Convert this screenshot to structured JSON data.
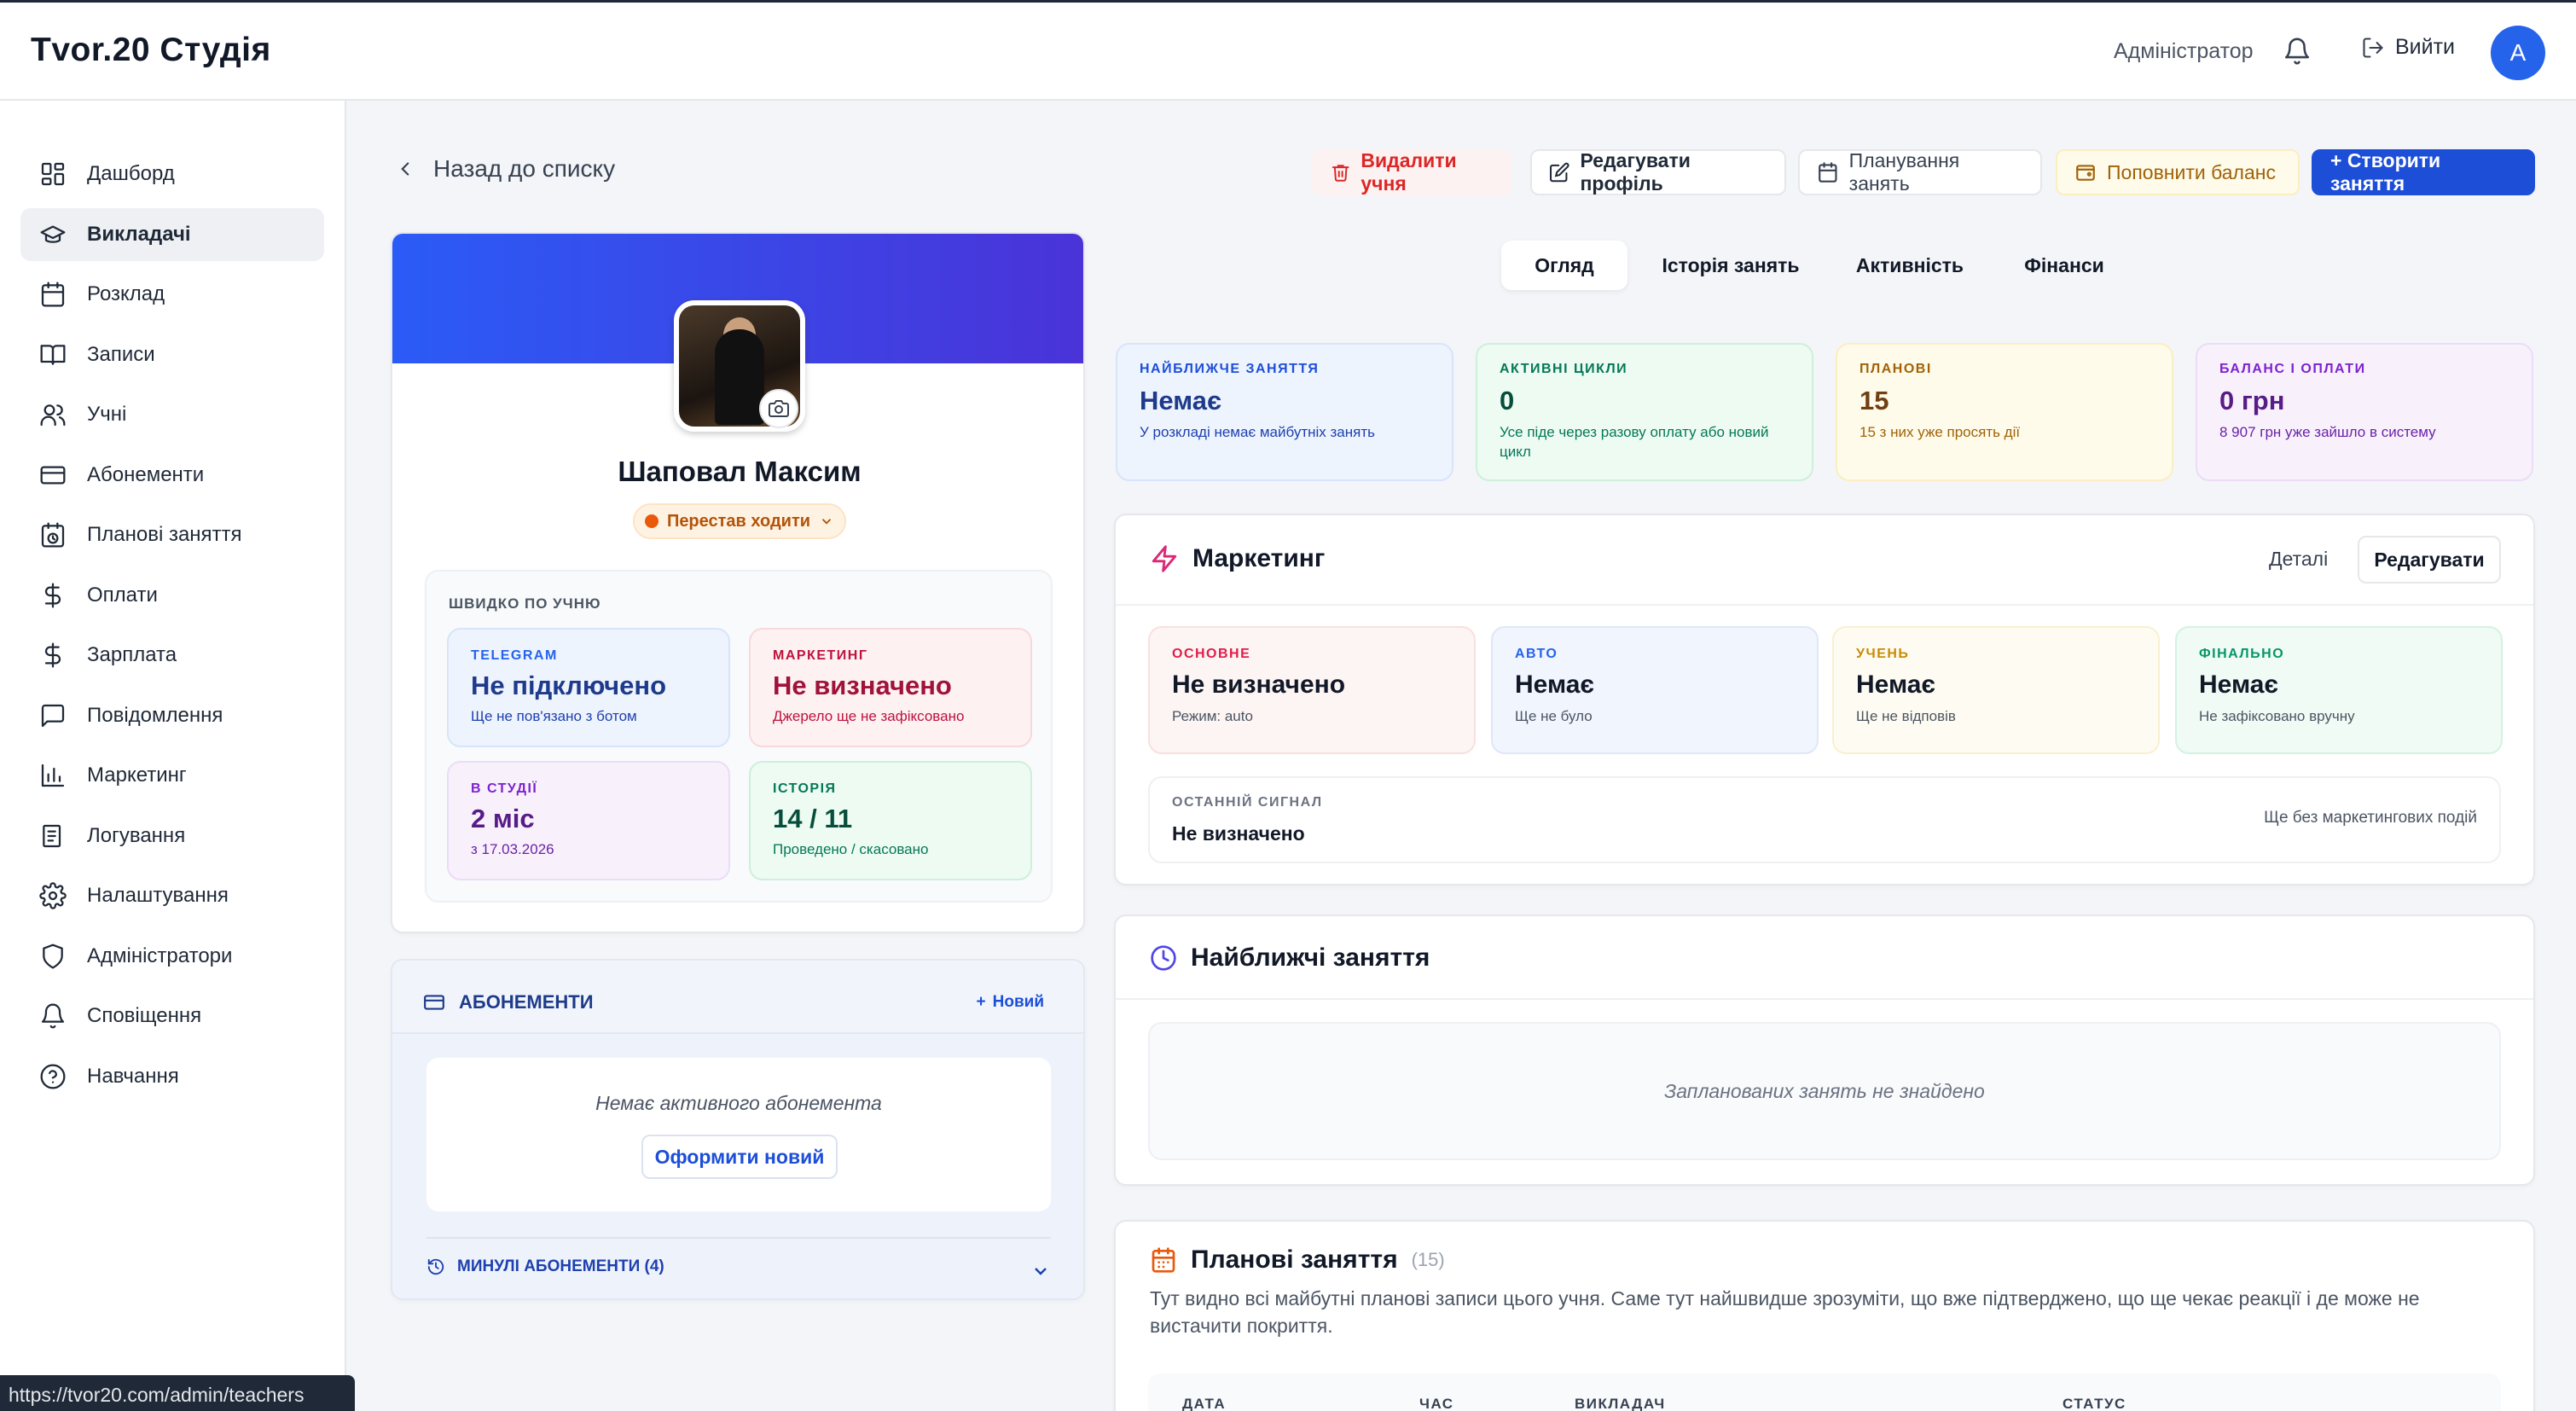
{
  "app": {
    "title": "Tvor.20 Студія"
  },
  "topbar": {
    "role": "Адміністратор",
    "logout": "Вийти",
    "avatar": "A"
  },
  "sidebar": {
    "items": [
      {
        "label": "Дашборд",
        "icon": "dashboard-icon"
      },
      {
        "label": "Викладачі",
        "icon": "graduation-cap-icon",
        "active": true
      },
      {
        "label": "Розклад",
        "icon": "calendar-icon"
      },
      {
        "label": "Записи",
        "icon": "book-icon"
      },
      {
        "label": "Учні",
        "icon": "users-icon"
      },
      {
        "label": "Абонементи",
        "icon": "credit-card-icon"
      },
      {
        "label": "Планові заняття",
        "icon": "calendar-clock-icon"
      },
      {
        "label": "Оплати",
        "icon": "dollar-icon"
      },
      {
        "label": "Зарплата",
        "icon": "dollar-icon"
      },
      {
        "label": "Повідомлення",
        "icon": "message-icon"
      },
      {
        "label": "Маркетинг",
        "icon": "bar-chart-icon"
      },
      {
        "label": "Логування",
        "icon": "log-icon"
      },
      {
        "label": "Налаштування",
        "icon": "gear-icon"
      },
      {
        "label": "Адміністратори",
        "icon": "shield-icon"
      },
      {
        "label": "Сповіщення",
        "icon": "bell-icon"
      },
      {
        "label": "Навчання",
        "icon": "help-icon"
      }
    ]
  },
  "statusbar": {
    "url": "https://tvor20.com/admin/teachers"
  },
  "toolbar": {
    "back": "Назад до списку",
    "delete": "Видалити учня",
    "edit": "Редагувати профіль",
    "plan": "Планування занять",
    "balance": "Поповнити баланс",
    "create": "+ Створити заняття"
  },
  "profile": {
    "name": "Шаповал Максим",
    "status": "Перестав ходити",
    "quick_title": "ШВИДКО ПО УЧНЮ",
    "tiles": [
      {
        "label": "TELEGRAM",
        "value": "Не підключено",
        "sub": "Ще не пов'язано з ботом"
      },
      {
        "label": "МАРКЕТИНГ",
        "value": "Не визначено",
        "sub": "Джерело ще не зафіксовано"
      },
      {
        "label": "В СТУДІЇ",
        "value": "2 міс",
        "sub": "з 17.03.2026"
      },
      {
        "label": "ІСТОРІЯ",
        "value": "14 / 11",
        "sub": "Проведено / скасовано"
      }
    ]
  },
  "subscriptions": {
    "title": "АБОНЕМЕНТИ",
    "new": "Новий",
    "empty": "Немає активного абонемента",
    "create": "Оформити новий",
    "past": "МИНУЛІ АБОНЕМЕНТИ (4)"
  },
  "tabs": [
    "Огляд",
    "Історія занять",
    "Активність",
    "Фінанси"
  ],
  "kpis": [
    {
      "label": "НАЙБЛИЖЧЕ ЗАНЯТТЯ",
      "value": "Немає",
      "sub": "У розкладі немає майбутніх занять"
    },
    {
      "label": "АКТИВНІ ЦИКЛИ",
      "value": "0",
      "sub": "Усе піде через разову оплату або новий цикл"
    },
    {
      "label": "ПЛАНОВІ",
      "value": "15",
      "sub": "15 з них уже просять дії"
    },
    {
      "label": "БАЛАНС І ОПЛАТИ",
      "value": "0 грн",
      "sub": "8 907 грн уже зайшло в систему"
    }
  ],
  "marketing": {
    "title": "Маркетинг",
    "details": "Деталі",
    "edit": "Редагувати",
    "tiles": [
      {
        "label": "ОСНОВНЕ",
        "value": "Не визначено",
        "sub": "Режим: auto"
      },
      {
        "label": "АВТО",
        "value": "Немає",
        "sub": "Ще не було"
      },
      {
        "label": "УЧЕНЬ",
        "value": "Немає",
        "sub": "Ще не відповів"
      },
      {
        "label": "ФІНАЛЬНО",
        "value": "Немає",
        "sub": "Не зафіксовано вручну"
      }
    ],
    "last_label": "ОСТАННІЙ СИГНАЛ",
    "last_value": "Не визначено",
    "last_note": "Ще без маркетингових подій"
  },
  "upcoming": {
    "title": "Найближчі заняття",
    "empty": "Запланованих занять не знайдено"
  },
  "planned": {
    "title": "Планові заняття",
    "count": "(15)",
    "desc": "Тут видно всі майбутні планові записи цього учня. Саме тут найшвидше зрозуміти, що вже підтверджено, що ще чекає реакції і де може не вистачити покриття.",
    "columns": [
      "ДАТА",
      "ЧАС",
      "ВИКЛАДАЧ",
      "СТАТУС"
    ]
  },
  "colors": {
    "accent": "#1d4ed8",
    "danger": "#dc2626",
    "warning": "#a16207",
    "success": "#047857",
    "purple": "#6b21a8"
  }
}
